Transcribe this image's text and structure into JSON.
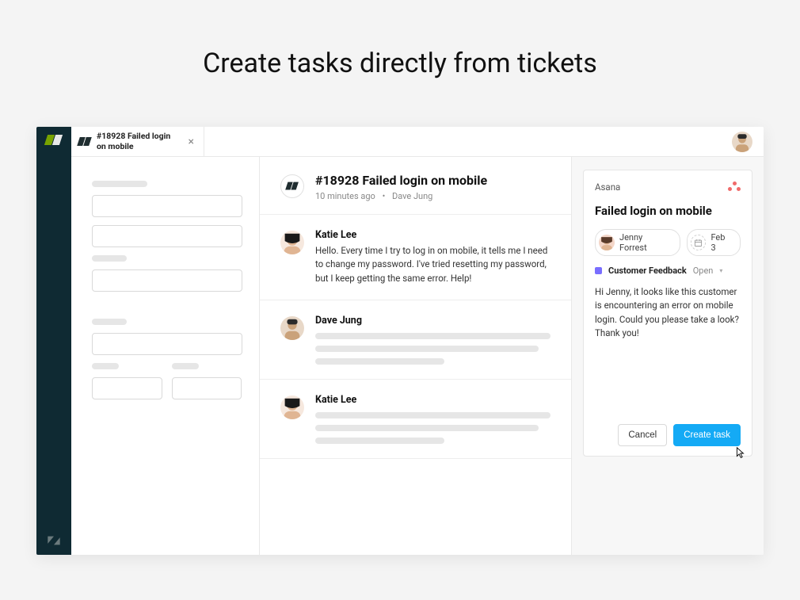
{
  "marketing_heading": "Create tasks directly from tickets",
  "tab": {
    "title": "#18928 Failed login on mobile"
  },
  "ticket": {
    "title": "#18928 Failed login on mobile",
    "time": "10 minutes ago",
    "dot": "•",
    "requester": "Dave Jung"
  },
  "conversation": [
    {
      "author": "Katie Lee",
      "text": "Hello. Every time I try to log in on mobile, it tells me I need to change my password. I've tried resetting my password, but I keep getting the same error. Help!"
    },
    {
      "author": "Dave Jung",
      "text": ""
    },
    {
      "author": "Katie Lee",
      "text": ""
    }
  ],
  "asana": {
    "provider_label": "Asana",
    "task_title": "Failed login on mobile",
    "assignee": "Jenny Forrest",
    "due_date": "Feb 3",
    "project_name": "Customer Feedback",
    "status_label": "Open",
    "description": "Hi Jenny, it looks like this customer is encountering an error on mobile login. Could you please take a look? Thank you!",
    "cancel_label": "Cancel",
    "create_label": "Create task"
  },
  "icons": {
    "calendar": "📅"
  }
}
